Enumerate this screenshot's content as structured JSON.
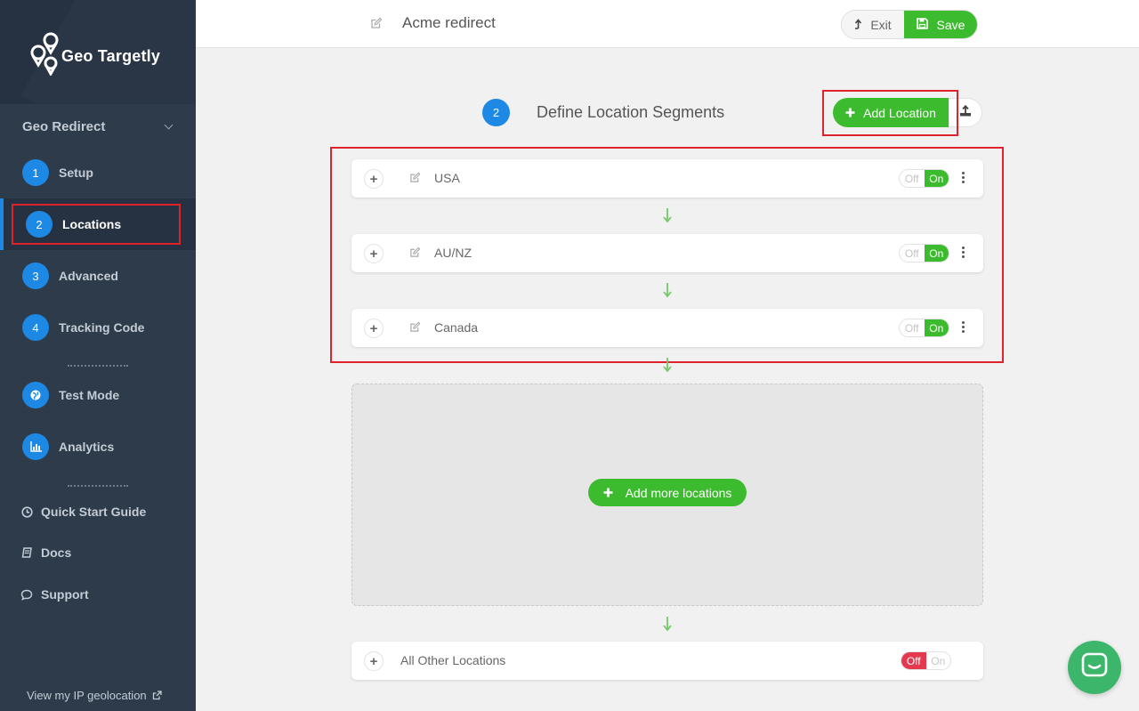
{
  "sidebar": {
    "brand": "Geo Targetly",
    "section_title": "Geo Redirect",
    "steps": [
      {
        "num": "1",
        "label": "Setup"
      },
      {
        "num": "2",
        "label": "Locations"
      },
      {
        "num": "3",
        "label": "Advanced"
      },
      {
        "num": "4",
        "label": "Tracking Code"
      }
    ],
    "extras": [
      {
        "label": "Test Mode",
        "icon": "globe-icon"
      },
      {
        "label": "Analytics",
        "icon": "bar-chart-icon"
      }
    ],
    "links": [
      {
        "label": "Quick Start Guide",
        "icon": "clock-icon"
      },
      {
        "label": "Docs",
        "icon": "book-icon"
      },
      {
        "label": "Support",
        "icon": "chat-bubble-icon"
      }
    ],
    "footer_link": "View my IP geolocation"
  },
  "topbar": {
    "title": "Acme redirect",
    "exit_label": "Exit",
    "save_label": "Save"
  },
  "section": {
    "step_num": "2",
    "title": "Define Location Segments",
    "add_location_label": "Add Location"
  },
  "locations": [
    {
      "name": "USA",
      "off_label": "Off",
      "on_label": "On",
      "state": "on"
    },
    {
      "name": "AU/NZ",
      "off_label": "Off",
      "on_label": "On",
      "state": "on"
    },
    {
      "name": "Canada",
      "off_label": "Off",
      "on_label": "On",
      "state": "on"
    }
  ],
  "dropzone": {
    "add_more_label": "Add more locations"
  },
  "fallback": {
    "name": "All Other Locations",
    "off_label": "Off",
    "on_label": "On",
    "state": "off"
  },
  "colors": {
    "sidebar_bg": "#2e3b4a",
    "accent_blue": "#1e88e5",
    "accent_green": "#3cbb2f",
    "off_red": "#e53950",
    "highlight_red": "#e0222c",
    "chat_green": "#3cb66b"
  }
}
